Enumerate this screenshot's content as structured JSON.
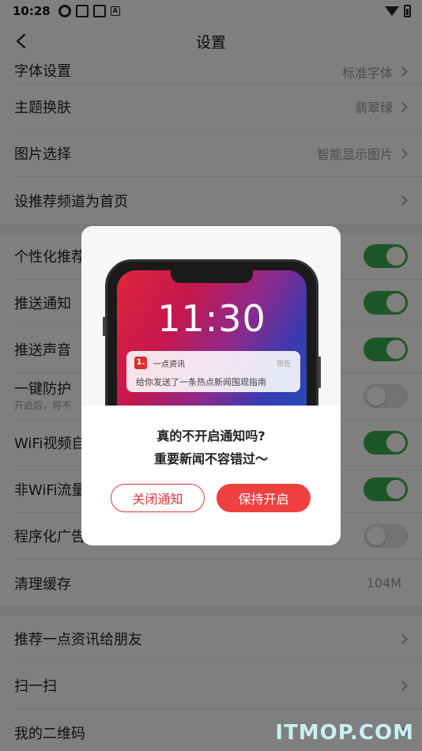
{
  "status_bar": {
    "time": "10:28",
    "a_icon_label": "A"
  },
  "navbar": {
    "title": "设置"
  },
  "group1": [
    {
      "label": "字体设置",
      "value": "标准字体"
    },
    {
      "label": "主题换肤",
      "value": "翡翠绿"
    },
    {
      "label": "图片选择",
      "value": "智能显示图片"
    },
    {
      "label": "设推荐频道为首页",
      "value": ""
    }
  ],
  "group2": [
    {
      "label": "个性化推荐",
      "toggle": "on"
    },
    {
      "label": "推送通知",
      "toggle": "on"
    },
    {
      "label": "推送声音",
      "toggle": "on"
    },
    {
      "label": "一键防护",
      "sub": "开启后，将不",
      "toggle": "off"
    },
    {
      "label": "WiFi视频自",
      "toggle": "on"
    },
    {
      "label": "非WiFi流量",
      "toggle": "on"
    },
    {
      "label": "程序化广告",
      "toggle": "off"
    },
    {
      "label": "清理缓存",
      "value": "104M"
    }
  ],
  "group3": [
    {
      "label": "推荐一点资讯给朋友"
    },
    {
      "label": "扫一扫"
    },
    {
      "label": "我的二维码"
    }
  ],
  "dialog": {
    "phone_time": "11:30",
    "notif_logo": "1.",
    "notif_app": "一点资讯",
    "notif_when": "现在",
    "notif_msg": "给你发送了一条热点新闻围观指南",
    "title": "真的不开启通知吗?",
    "subtitle": "重要新闻不容错过～",
    "close_button": "关闭通知",
    "keep_button": "保持开启"
  },
  "watermark": "ITMOP.COM",
  "colors": {
    "accent_green": "#3dae4e",
    "brand_red": "#ef3f3f"
  }
}
